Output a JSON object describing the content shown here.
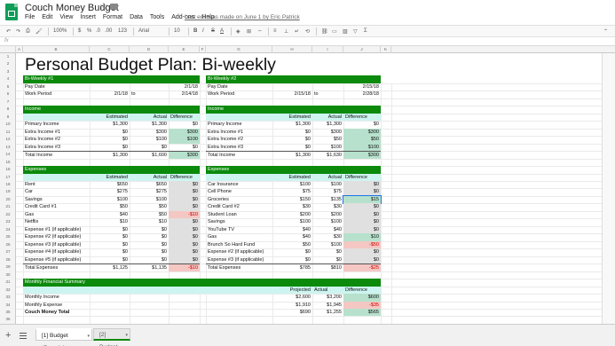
{
  "window": {
    "title": "Couch Money Budget",
    "last_edit": "Last edit was made on June 1 by Eric Patrick",
    "menu": [
      "File",
      "Edit",
      "View",
      "Insert",
      "Format",
      "Data",
      "Tools",
      "Add-ons",
      "Help"
    ]
  },
  "toolbar": {
    "zoom": "100%",
    "currency": "$",
    "percent": "%",
    "dec_less": ".0",
    "dec_more": ".00",
    "more_formats": "123",
    "font": "Arial",
    "font_size": "10",
    "bold": "B",
    "italic": "I",
    "strike": "S",
    "text_color": "A"
  },
  "formula_bar": {
    "label": "fx"
  },
  "columns": [
    "A",
    "B",
    "C",
    "D",
    "E",
    "F",
    "G",
    "H",
    "I",
    "J",
    "K"
  ],
  "rows": [
    "1",
    "2",
    "3",
    "4",
    "5",
    "6",
    "7",
    "8",
    "9",
    "10",
    "11",
    "12",
    "13",
    "14",
    "15",
    "16",
    "17",
    "18",
    "19",
    "20",
    "21",
    "22",
    "23",
    "24",
    "25",
    "26",
    "27",
    "28",
    "29",
    "30",
    "31",
    "32",
    "33",
    "34",
    "35",
    "36"
  ],
  "sheet": {
    "title": "Personal Budget Plan: Bi-weekly",
    "left": {
      "header": "Bi-Weekly #1",
      "pay_date_label": "Pay Date",
      "pay_date": "2/1/18",
      "work_period_label": "Work Period",
      "work_from": "2/1/18",
      "work_to_label": "to",
      "work_to": "2/14/18",
      "income_header": "Income",
      "col_estimated": "Estimated",
      "col_actual": "Actual",
      "col_difference": "Difference",
      "income_rows": [
        {
          "name": "Primary Income",
          "est": "$1,300",
          "act": "$1,300",
          "diff": "$0",
          "style": "plain"
        },
        {
          "name": "Extra Income #1",
          "est": "$0",
          "act": "$300",
          "diff": "$300",
          "style": "green"
        },
        {
          "name": "Extra Income #2",
          "est": "$0",
          "act": "$100",
          "diff": "$100",
          "style": "green"
        },
        {
          "name": "Extra Income #3",
          "est": "$0",
          "act": "$0",
          "diff": "$0",
          "style": "plain"
        },
        {
          "name": "Total Income",
          "est": "$1,300",
          "act": "$1,600",
          "diff": "$300",
          "style": "green"
        }
      ],
      "expenses_header": "Expenses",
      "expense_rows": [
        {
          "name": "Rent",
          "est": "$650",
          "act": "$650",
          "diff": "$0",
          "style": "grey"
        },
        {
          "name": "Car",
          "est": "$275",
          "act": "$275",
          "diff": "$0",
          "style": "grey"
        },
        {
          "name": "Savings",
          "est": "$100",
          "act": "$100",
          "diff": "$0",
          "style": "grey"
        },
        {
          "name": "Credit Card #1",
          "est": "$50",
          "act": "$50",
          "diff": "$0",
          "style": "grey"
        },
        {
          "name": "Gas",
          "est": "$40",
          "act": "$50",
          "diff": "-$10",
          "style": "red"
        },
        {
          "name": "Netflix",
          "est": "$10",
          "act": "$10",
          "diff": "$0",
          "style": "grey"
        },
        {
          "name": "Expense #1 (if applicable)",
          "est": "$0",
          "act": "$0",
          "diff": "$0",
          "style": "grey"
        },
        {
          "name": "Expense #2 (if applicable)",
          "est": "$0",
          "act": "$0",
          "diff": "$0",
          "style": "grey"
        },
        {
          "name": "Expense #3 (if applicable)",
          "est": "$0",
          "act": "$0",
          "diff": "$0",
          "style": "grey"
        },
        {
          "name": "Expense #4 (if applicable)",
          "est": "$0",
          "act": "$0",
          "diff": "$0",
          "style": "grey"
        },
        {
          "name": "Expense #5 (if applicable)",
          "est": "$0",
          "act": "$0",
          "diff": "$0",
          "style": "grey"
        },
        {
          "name": "Total Expenses",
          "est": "$1,125",
          "act": "$1,135",
          "diff": "-$10",
          "style": "red"
        }
      ]
    },
    "right": {
      "header": "Bi-Weekly #2",
      "pay_date_label": "Pay Date",
      "pay_date": "2/15/18",
      "work_period_label": "Work Period",
      "work_from": "2/15/18",
      "work_to_label": "to",
      "work_to": "2/28/18",
      "income_header": "Income",
      "col_estimated": "Estimated",
      "col_actual": "Actual",
      "col_difference": "Difference",
      "income_rows": [
        {
          "name": "Primary Income",
          "est": "$1,300",
          "act": "$1,300",
          "diff": "$0",
          "style": "plain"
        },
        {
          "name": "Extra Income #1",
          "est": "$0",
          "act": "$300",
          "diff": "$300",
          "style": "green"
        },
        {
          "name": "Extra Income #2",
          "est": "$0",
          "act": "$50",
          "diff": "$50",
          "style": "green"
        },
        {
          "name": "Extra Income #3",
          "est": "$0",
          "act": "$100",
          "diff": "$100",
          "style": "green"
        },
        {
          "name": "Total Income",
          "est": "$1,300",
          "act": "$1,630",
          "diff": "$300",
          "style": "green"
        }
      ],
      "expenses_header": "Expenses",
      "expense_rows": [
        {
          "name": "Car Insurance",
          "est": "$100",
          "act": "$100",
          "diff": "$0",
          "style": "grey"
        },
        {
          "name": "Cell Phone",
          "est": "$75",
          "act": "$75",
          "diff": "$0",
          "style": "grey"
        },
        {
          "name": "Groceries",
          "est": "$150",
          "act": "$135",
          "diff": "$15",
          "style": "green"
        },
        {
          "name": "Credit Card #2",
          "est": "$30",
          "act": "$30",
          "diff": "$0",
          "style": "grey"
        },
        {
          "name": "Student Loan",
          "est": "$200",
          "act": "$200",
          "diff": "$0",
          "style": "grey"
        },
        {
          "name": "Savings",
          "est": "$100",
          "act": "$100",
          "diff": "$0",
          "style": "grey"
        },
        {
          "name": "YouTube TV",
          "est": "$40",
          "act": "$40",
          "diff": "$0",
          "style": "grey"
        },
        {
          "name": "Gas",
          "est": "$40",
          "act": "$30",
          "diff": "$10",
          "style": "green"
        },
        {
          "name": "Brunch So Hard Fund",
          "est": "$50",
          "act": "$100",
          "diff": "-$50",
          "style": "red"
        },
        {
          "name": "Expense #2 (if applicable)",
          "est": "$0",
          "act": "$0",
          "diff": "$0",
          "style": "grey"
        },
        {
          "name": "Expense #3 (if applicable)",
          "est": "$0",
          "act": "$0",
          "diff": "$0",
          "style": "grey"
        },
        {
          "name": "Total Expenses",
          "est": "$785",
          "act": "$810",
          "diff": "-$25",
          "style": "red"
        }
      ]
    },
    "summary": {
      "header": "Monthly Financial Summary",
      "col_projected": "Projected",
      "col_actual": "Actual",
      "col_difference": "Difference",
      "rows": [
        {
          "name": "Monthly Income",
          "proj": "$2,600",
          "act": "$3,200",
          "diff": "$600",
          "style": "green",
          "bold": false
        },
        {
          "name": "Monthly Expense",
          "proj": "$1,910",
          "act": "$1,945",
          "diff": "-$35",
          "style": "red",
          "bold": false
        },
        {
          "name": "Couch Money Total",
          "proj": "$690",
          "act": "$1,255",
          "diff": "$565",
          "style": "green",
          "bold": true
        }
      ]
    }
  },
  "tabs": [
    {
      "label": "[1] Budget (Sample)",
      "active": true
    },
    {
      "label": "[2] Budget",
      "active": false
    }
  ],
  "colors": {
    "band": "#0b8a0b",
    "subhead": "#cdf4f0",
    "positive": "#b7e1cd",
    "negative": "#f4c7c3"
  }
}
